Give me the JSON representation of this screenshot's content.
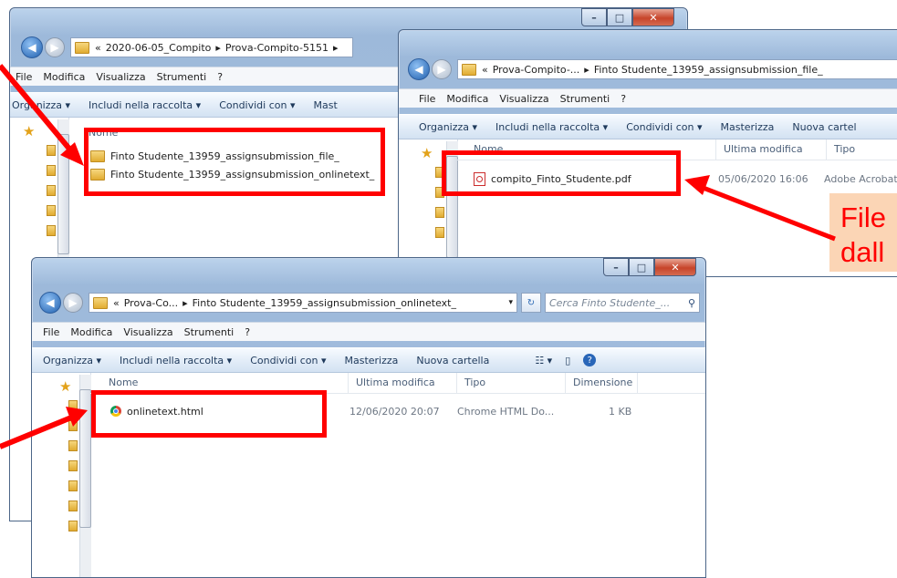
{
  "window1": {
    "address_parts": [
      "«",
      "2020-06-05_Compito",
      "▸",
      "Prova-Compito-5151",
      "▸"
    ],
    "menu": [
      "File",
      "Modifica",
      "Visualizza",
      "Strumenti",
      "?"
    ],
    "toolbar": [
      "Organizza ▾",
      "Includi nella raccolta ▾",
      "Condividi con ▾",
      "Mast"
    ],
    "col_nome": "Nome",
    "rows": [
      "Finto Studente_13959_assignsubmission_file_",
      "Finto Studente_13959_assignsubmission_onlinetext_"
    ]
  },
  "window2": {
    "address_parts": [
      "«",
      "Prova-Compito-...",
      "▸",
      "Finto Studente_13959_assignsubmission_file_"
    ],
    "menu": [
      "File",
      "Modifica",
      "Visualizza",
      "Strumenti",
      "?"
    ],
    "toolbar": [
      "Organizza ▾",
      "Includi nella raccolta ▾",
      "Condividi con ▾",
      "Masterizza",
      "Nuova cartel"
    ],
    "columns": [
      "Nome",
      "Ultima modifica",
      "Tipo"
    ],
    "file": {
      "name": "compito_Finto_Studente.pdf",
      "modified": "05/06/2020 16:06",
      "type": "Adobe Acrobat"
    }
  },
  "window3": {
    "address_parts": [
      "«",
      "Prova-Co...",
      "▸",
      "Finto Studente_13959_assignsubmission_onlinetext_"
    ],
    "search_placeholder": "Cerca Finto Studente_...",
    "menu": [
      "File",
      "Modifica",
      "Visualizza",
      "Strumenti",
      "?"
    ],
    "toolbar": [
      "Organizza ▾",
      "Includi nella raccolta ▾",
      "Condividi con ▾",
      "Masterizza",
      "Nuova cartella"
    ],
    "columns": [
      "Nome",
      "Ultima modifica",
      "Tipo",
      "Dimensione"
    ],
    "file": {
      "name": "onlinetext.html",
      "modified": "12/06/2020 20:07",
      "type": "Chrome HTML Do...",
      "size": "1 KB"
    }
  },
  "callout": {
    "line1": "File",
    "line2": "dall"
  },
  "colors": {
    "highlight": "#ff0000",
    "callout_bg": "#fbd5b5"
  },
  "icons": [
    "back-arrow-icon",
    "forward-arrow-icon",
    "folder-icon",
    "pdf-icon",
    "chrome-icon",
    "star-icon",
    "search-icon",
    "refresh-icon",
    "help-icon"
  ]
}
